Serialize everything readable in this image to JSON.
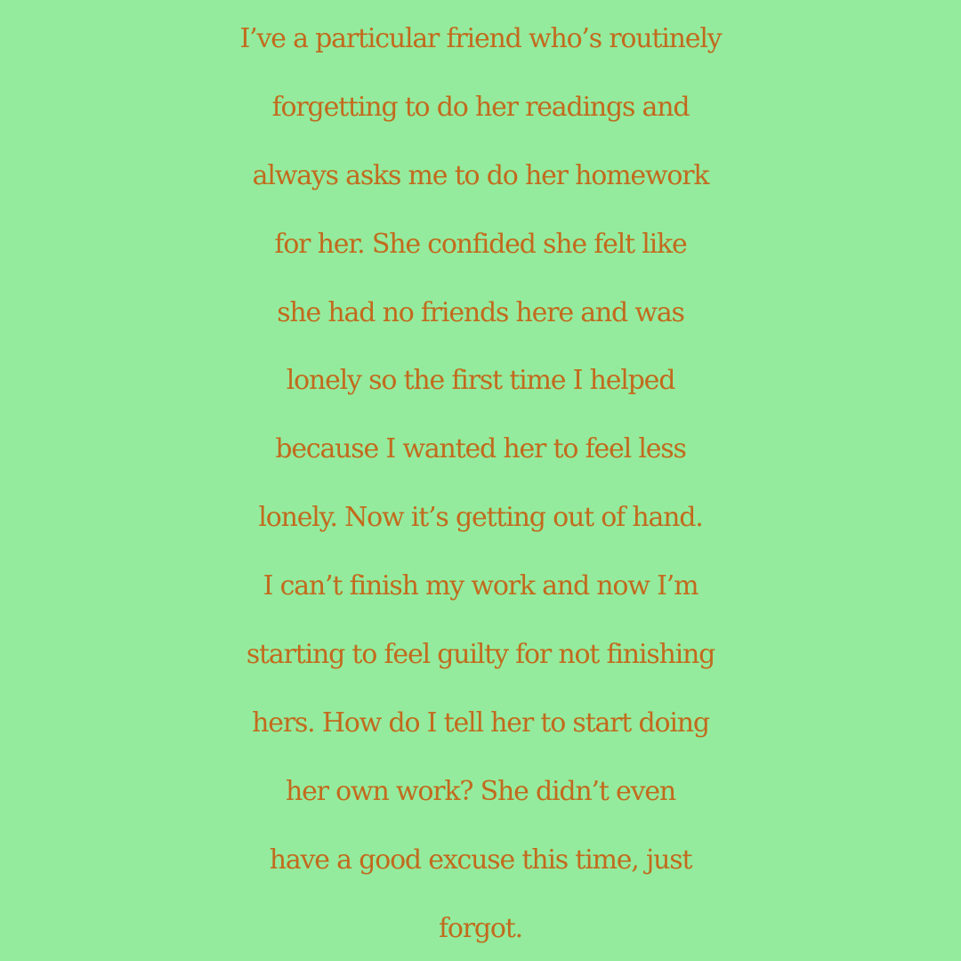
{
  "colors": {
    "background": "#94eb9d",
    "text": "#c26a1d"
  },
  "post": {
    "lines": [
      "I’ve a particular friend who’s routinely",
      "forgetting to do her readings and",
      "always asks me to do her homework",
      "for her. She confided she felt like",
      "she had no friends here and was",
      "lonely so the first time I helped",
      "because I wanted her to feel less",
      "lonely. Now it’s getting out of hand.",
      "I can’t finish my work and now I’m",
      "starting to feel guilty for not finishing",
      "hers. How do I tell her to start doing",
      "her own work? She didn’t even",
      "have a good excuse this time, just",
      "forgot."
    ]
  }
}
